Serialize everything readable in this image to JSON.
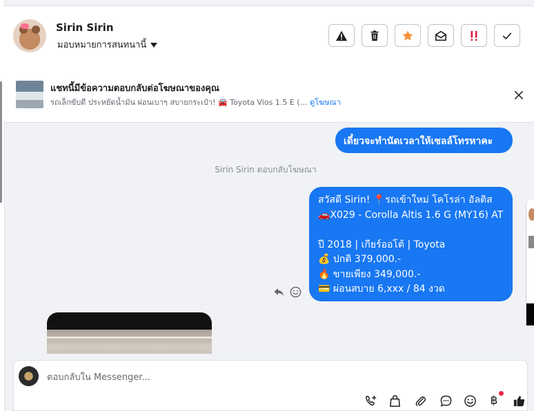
{
  "header": {
    "name": "Sirin Sirin",
    "assign_label": "มอบหมายการสนทนานี้",
    "actions": [
      {
        "id": "report",
        "icon": "warning-icon"
      },
      {
        "id": "delete",
        "icon": "trash-icon"
      },
      {
        "id": "star",
        "icon": "star-icon",
        "color": "#f7923a"
      },
      {
        "id": "mark-unread",
        "icon": "envelope-open-icon"
      },
      {
        "id": "follow-up",
        "icon": "double-exclamation-icon",
        "color": "#e41e3f"
      },
      {
        "id": "done",
        "icon": "check-icon"
      }
    ]
  },
  "ad_banner": {
    "title": "แชทนี้มีข้อความตอบกลับต่อโฆษณาของคุณ",
    "subtitle": "รถเล็กขับดี ประหยัดน้ำมัน ผ่อนเบาๆ สบายกระเป๋า! 🚘 Toyota Vios 1.5 E (...",
    "link": "ดูโฆษณา"
  },
  "messages": {
    "outgoing_1": "เดี๋ยวจะทำนัดเวลาให้เซลล์โทรหาคะ",
    "meta": "Sirin Sirin ตอบกลับโฆษณา",
    "outgoing_2": {
      "line1": "สวัสดี Sirin! 📍รถเข้าใหม่ โคโรล่า อัลติส",
      "line2": "🚗X029 - Corolla Altis 1.6 G (MY16) AT",
      "line3": "",
      "line4": "ปี 2018 | เกียร์ออโต้ | Toyota",
      "line5": "💰 ปกติ 379,000.-",
      "line6": "🔥 ขายเพียง 349,000.-",
      "line7": "💳 ผ่อนสบาย 6,xxx / 84 งวด"
    }
  },
  "composer": {
    "placeholder": "ตอบกลับใน Messenger...",
    "tools": [
      "add-contact-icon",
      "bag-icon",
      "paperclip-icon",
      "saved-reply-icon",
      "emoji-icon",
      "baht-icon",
      "thumbs-up-icon"
    ],
    "baht_symbol": "฿"
  },
  "colors": {
    "accent": "#1877f2",
    "background": "#f0f2f5",
    "surface": "#ffffff"
  }
}
